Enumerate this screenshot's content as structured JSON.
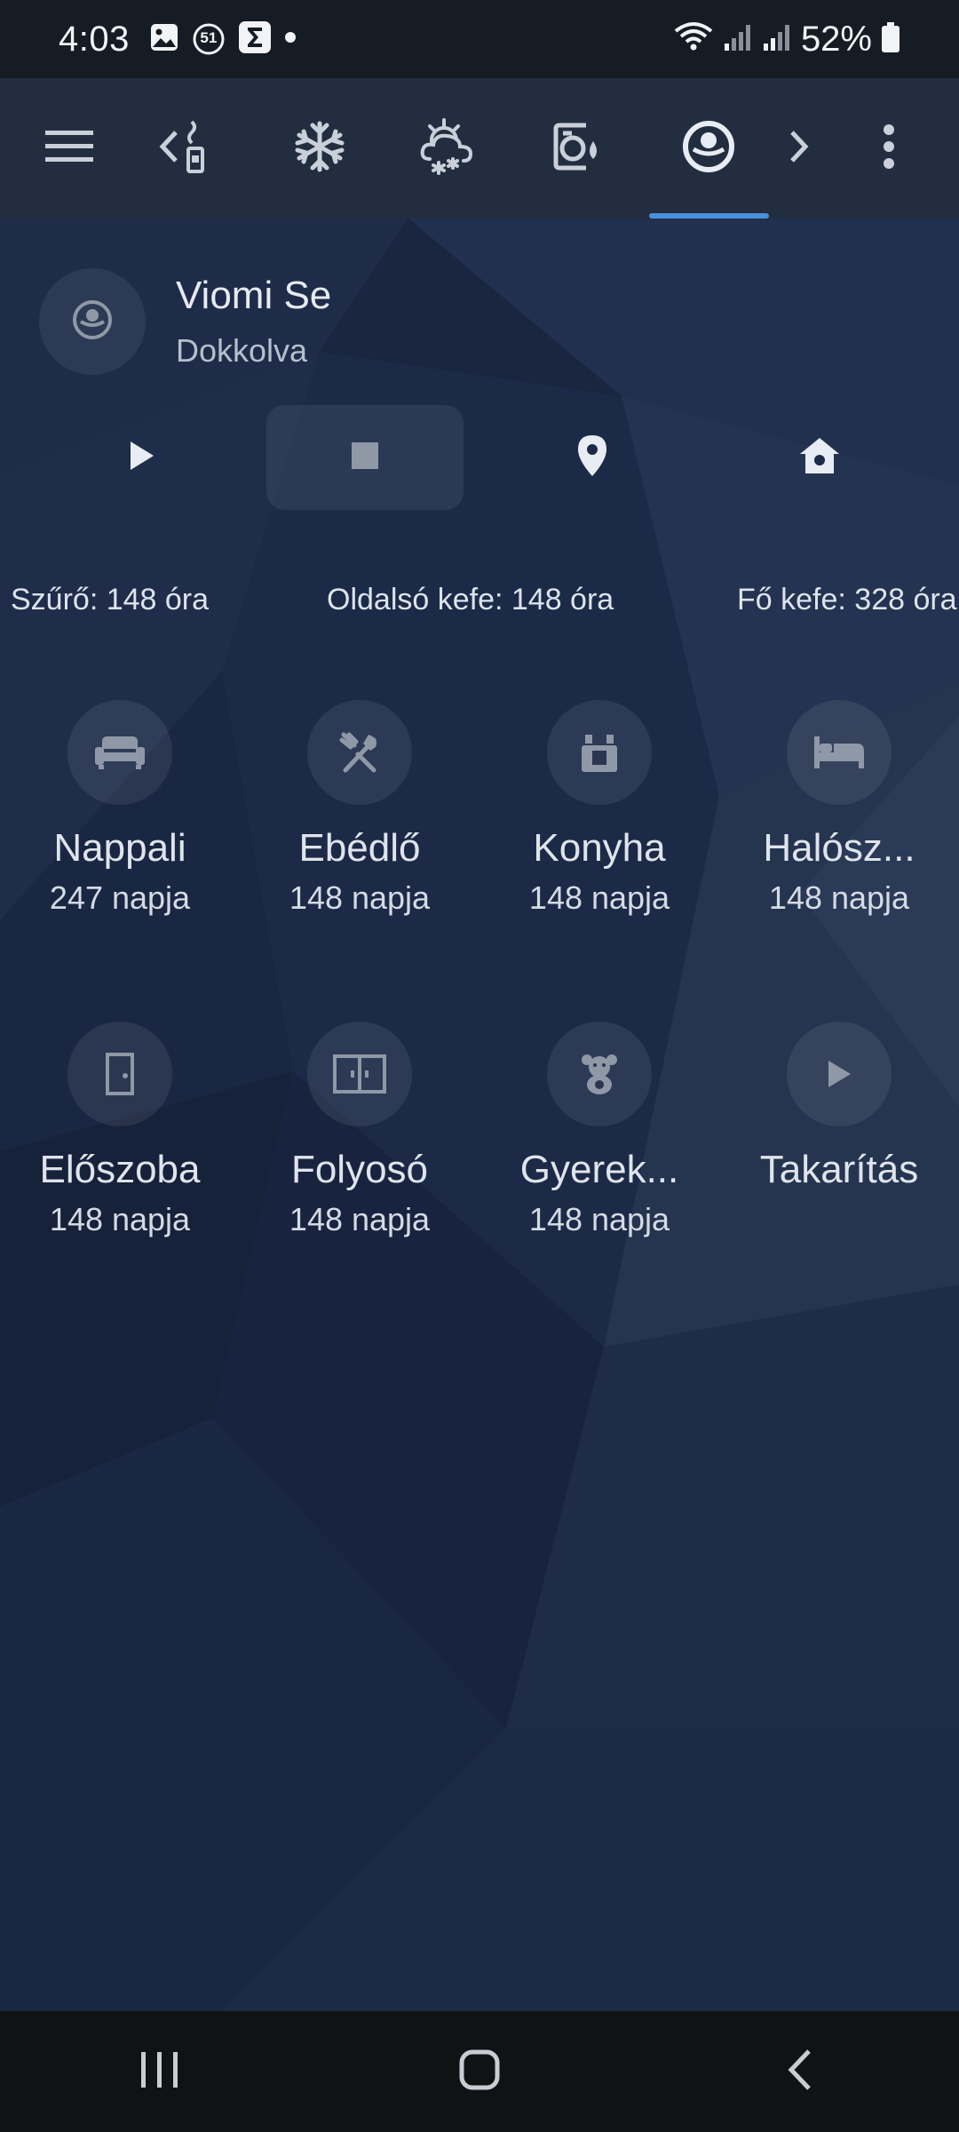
{
  "status_bar": {
    "time": "4:03",
    "notification_badge": "51",
    "battery": "52%"
  },
  "toolbar": {
    "tabs": [
      {
        "icon": "faucet-icon"
      },
      {
        "icon": "snowflake-icon"
      },
      {
        "icon": "weather-snow-icon"
      },
      {
        "icon": "washing-machine-icon"
      },
      {
        "icon": "robot-vacuum-icon",
        "active": true
      }
    ],
    "accent_color": "#4a8fd8"
  },
  "vacuum": {
    "name": "Viomi Se",
    "status": "Dokkolva",
    "controls": [
      {
        "icon": "play-icon",
        "active": false
      },
      {
        "icon": "stop-icon",
        "active": true
      },
      {
        "icon": "locate-pin-icon",
        "active": false
      },
      {
        "icon": "return-home-icon",
        "active": false
      }
    ],
    "stats": {
      "filter": "Szűrő: 148 óra",
      "side_brush": "Oldalsó kefe: 148 óra",
      "main_brush": "Fő kefe: 328 óra"
    }
  },
  "rooms": [
    {
      "name": "Nappali",
      "sub": "247 napja",
      "icon": "sofa-icon"
    },
    {
      "name": "Ebédlő",
      "sub": "148 napja",
      "icon": "silverware-icon"
    },
    {
      "name": "Konyha",
      "sub": "148 napja",
      "icon": "stove-icon"
    },
    {
      "name": "Halósz...",
      "sub": "148 napja",
      "icon": "bed-icon"
    },
    {
      "name": "Előszoba",
      "sub": "148 napja",
      "icon": "door-icon"
    },
    {
      "name": "Folyosó",
      "sub": "148 napja",
      "icon": "wardrobe-icon"
    },
    {
      "name": "Gyerek...",
      "sub": "148 napja",
      "icon": "teddy-bear-icon"
    },
    {
      "name": "Takarítás",
      "sub": "",
      "icon": "play-icon"
    }
  ]
}
